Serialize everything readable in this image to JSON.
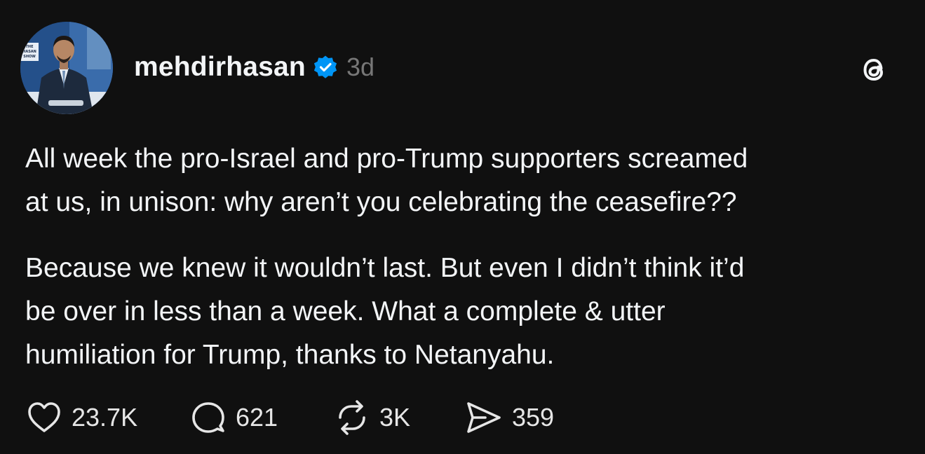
{
  "post": {
    "username": "mehdirhasan",
    "timestamp": "3d",
    "avatar_caption": "THE HASAN SHOW",
    "paragraphs": [
      "All week the pro-Israel and pro-Trump supporters screamed\nat us, in unison: why aren’t you celebrating the ceasefire??",
      "Because we knew it wouldn’t last. But even I didn’t think it’d\nbe over in less than a week. What a complete & utter\nhumiliation for Trump, thanks to Netanyahu."
    ],
    "actions": {
      "likes": "23.7K",
      "replies": "621",
      "reposts": "3K",
      "shares": "359"
    }
  },
  "icons": {
    "verified": "verified-badge-icon",
    "threads": "threads-logo-icon",
    "like": "heart-icon",
    "reply": "speech-bubble-icon",
    "repost": "repost-arrows-icon",
    "share": "send-icon"
  },
  "colors": {
    "background": "#101010",
    "text": "#f3f5f7",
    "muted": "#777777",
    "verified": "#0095f6"
  }
}
